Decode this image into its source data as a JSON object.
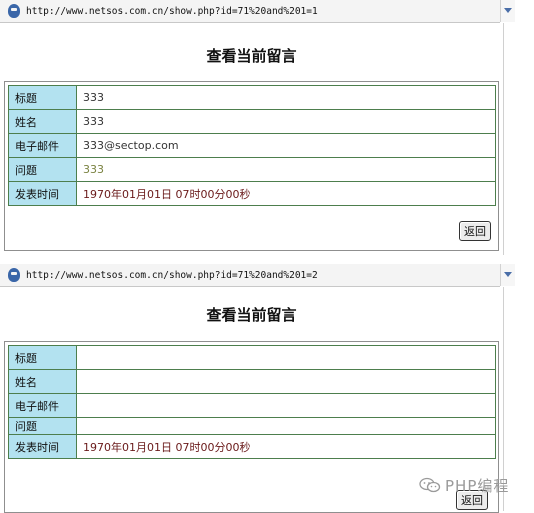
{
  "top": {
    "url": "http://www.netsos.com.cn/show.php?id=71%20and%201=1",
    "page_title": "查看当前留言",
    "rows": [
      {
        "label": "标题",
        "value": "333",
        "style": "plain"
      },
      {
        "label": "姓名",
        "value": "333",
        "style": "plain"
      },
      {
        "label": "电子邮件",
        "value": "333@sectop.com",
        "style": "plain"
      },
      {
        "label": "问题",
        "value": "333",
        "style": "olive"
      },
      {
        "label": "发表时间",
        "value": "1970年01月01日 07时00分00秒",
        "style": "maroon"
      }
    ],
    "back_label": "返回"
  },
  "bottom": {
    "url": "http://www.netsos.com.cn/show.php?id=71%20and%201=2",
    "page_title": "查看当前留言",
    "rows": [
      {
        "label": "标题",
        "value": "",
        "style": "plain"
      },
      {
        "label": "姓名",
        "value": "",
        "style": "plain"
      },
      {
        "label": "电子邮件",
        "value": "",
        "style": "plain"
      },
      {
        "label": "问题",
        "value": "",
        "style": "plain"
      },
      {
        "label": "发表时间",
        "value": "1970年01月01日 07时00分00秒",
        "style": "maroon"
      }
    ],
    "back_label": "返回"
  },
  "watermark": {
    "text": "PHP编程",
    "icon": "wechat-icon"
  }
}
